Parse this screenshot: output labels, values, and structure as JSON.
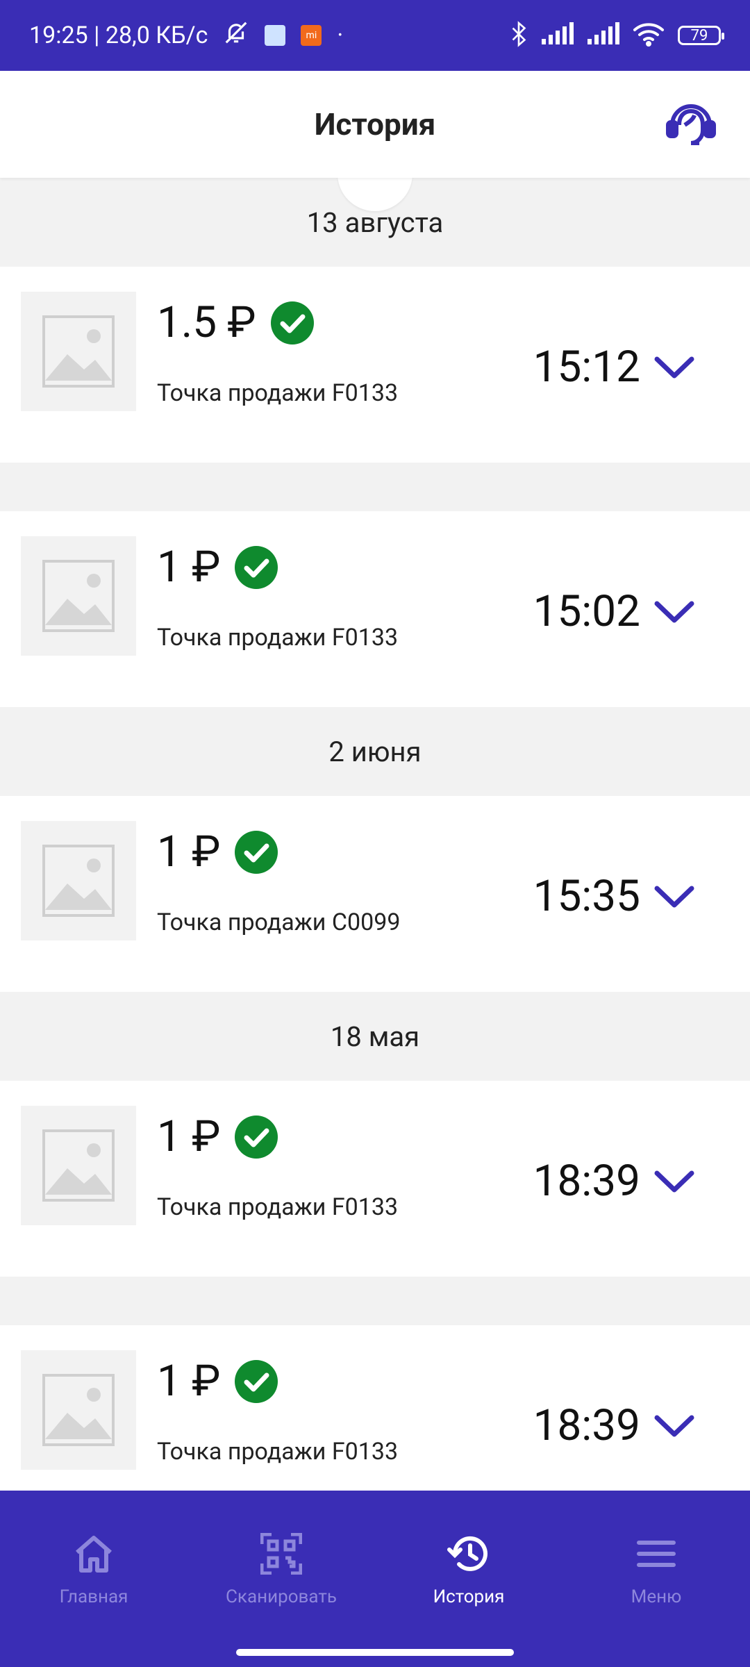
{
  "status_bar": {
    "time_speed": "19:25 | 28,0 КБ/с",
    "battery": "79",
    "dot": "·",
    "mi_label": "mi"
  },
  "header": {
    "title": "История"
  },
  "colors": {
    "brand": "#3a2db5",
    "success": "#0f8a2e",
    "nav_inactive": "#8d86dc"
  },
  "list": [
    {
      "date": "13 августа",
      "items": [
        {
          "amount": "1.5 ₽",
          "merchant": "Точка продажи F0133",
          "time": "15:12"
        },
        {
          "amount": "1 ₽",
          "merchant": "Точка продажи F0133",
          "time": "15:02"
        }
      ]
    },
    {
      "date": "2 июня",
      "items": [
        {
          "amount": "1 ₽",
          "merchant": "Точка продажи C0099",
          "time": "15:35"
        }
      ]
    },
    {
      "date": "18 мая",
      "items": [
        {
          "amount": "1 ₽",
          "merchant": "Точка продажи F0133",
          "time": "18:39"
        },
        {
          "amount": "1 ₽",
          "merchant": "Точка продажи F0133",
          "time": "18:39"
        }
      ]
    }
  ],
  "nav": [
    {
      "label": "Главная",
      "icon": "home-icon"
    },
    {
      "label": "Сканировать",
      "icon": "qr-scan-icon"
    },
    {
      "label": "История",
      "icon": "history-icon",
      "active": true
    },
    {
      "label": "Меню",
      "icon": "menu-icon"
    }
  ]
}
